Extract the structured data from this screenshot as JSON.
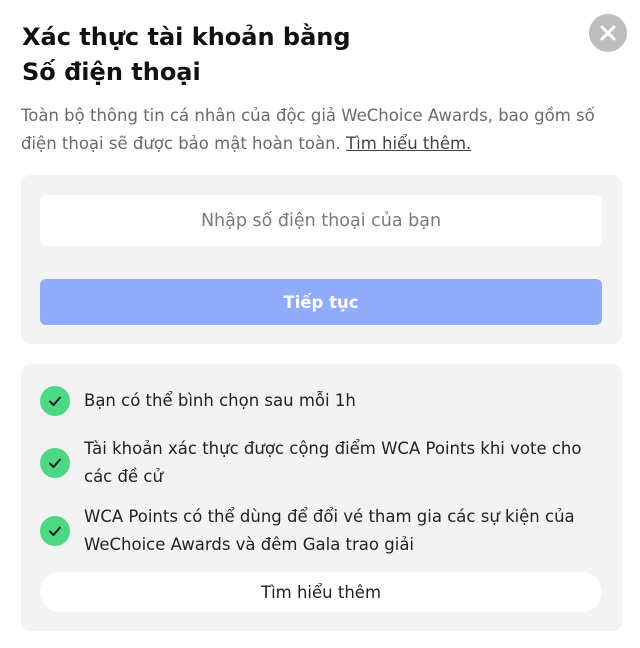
{
  "header": {
    "title_line1": "Xác thực tài khoản bằng",
    "title_line2": "Số điện thoại",
    "close_icon": "close-icon"
  },
  "description": {
    "text": "Toàn bộ thông tin cá nhân của độc giả WeChoice Awards, bao gồm số điện thoại sẽ được bảo mật hoàn toàn. ",
    "link_label": "Tìm hiểu thêm."
  },
  "form": {
    "phone_placeholder": "Nhập số điện thoại của bạn",
    "phone_value": "",
    "continue_label": "Tiếp tục",
    "continue_color": "#8fabfa"
  },
  "benefits": {
    "items": [
      {
        "icon": "check-icon",
        "text": "Bạn có thể bình chọn sau mỗi 1h"
      },
      {
        "icon": "check-icon",
        "text": "Tài khoản xác thực được cộng điểm WCA Points khi vote cho các đề cử"
      },
      {
        "icon": "check-icon",
        "text": "WCA Points có thể dùng để đổi vé tham gia các sự kiện của WeChoice Awards và đêm Gala trao giải"
      }
    ],
    "check_color": "#4cd884",
    "learn_more_label": "Tìm hiểu thêm"
  }
}
